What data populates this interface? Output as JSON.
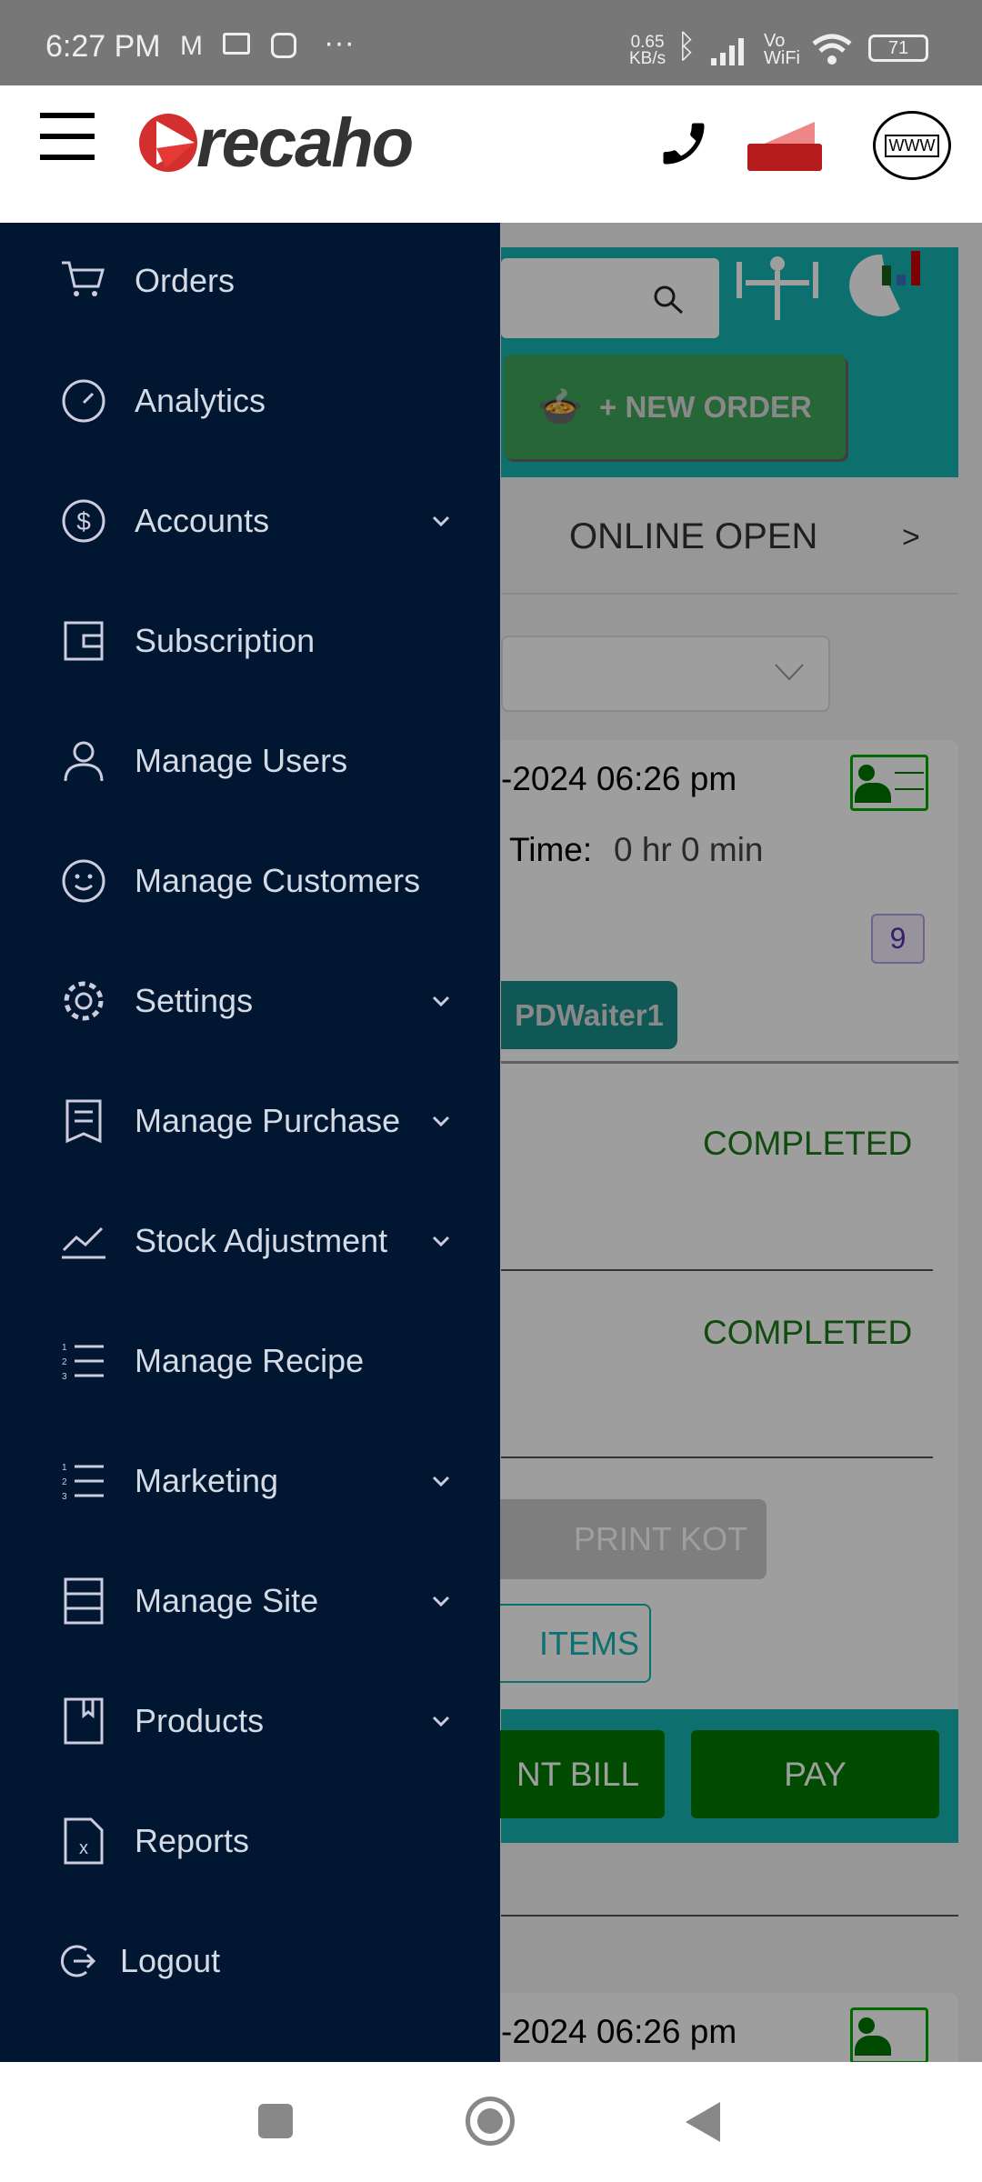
{
  "status_bar": {
    "time": "6:27 PM",
    "net_speed_value": "0.65",
    "net_speed_unit": "KB/s",
    "vo": "Vo",
    "wifi_label": "WiFi",
    "battery": "71",
    "more": "···"
  },
  "header": {
    "brand": "recaho",
    "brand_color": "#d32f2f",
    "icons": [
      "menu-icon",
      "phone-icon",
      "ticket-settings-icon",
      "www-globe-icon"
    ],
    "www": "WWW"
  },
  "background": {
    "new_order": "+ NEW ORDER",
    "tab": "ONLINE OPEN",
    "tab_next": ">",
    "card1": {
      "date": "-2024 06:26 pm",
      "time_label": "Time:",
      "time_value": "0 hr 0 min",
      "badge": "9",
      "waiter": "PDWaiter1"
    },
    "status1": "COMPLETED",
    "status2": "COMPLETED",
    "print_kot": "PRINT KOT",
    "items": "ITEMS",
    "print_bill": "NT BILL",
    "pay": "PAY",
    "card2": {
      "date": "-2024 06:26 pm"
    }
  },
  "drawer": {
    "items": [
      {
        "label": "Orders",
        "icon": "cart-icon",
        "expand": false
      },
      {
        "label": "Analytics",
        "icon": "speedometer-icon",
        "expand": false
      },
      {
        "label": "Accounts",
        "icon": "dollar-icon",
        "expand": true
      },
      {
        "label": "Subscription",
        "icon": "wallet-icon",
        "expand": false
      },
      {
        "label": "Manage Users",
        "icon": "user-icon",
        "expand": false
      },
      {
        "label": "Manage Customers",
        "icon": "smile-icon",
        "expand": false
      },
      {
        "label": "Settings",
        "icon": "gear-icon",
        "expand": true
      },
      {
        "label": "Manage Purchase",
        "icon": "receipt-icon",
        "expand": true
      },
      {
        "label": "Stock Adjustment",
        "icon": "chart-line-icon",
        "expand": true
      },
      {
        "label": "Manage Recipe",
        "icon": "list-icon",
        "expand": false
      },
      {
        "label": "Marketing",
        "icon": "list-icon",
        "expand": true
      },
      {
        "label": "Manage Site",
        "icon": "site-icon",
        "expand": true
      },
      {
        "label": "Products",
        "icon": "bookmark-icon",
        "expand": true
      },
      {
        "label": "Reports",
        "icon": "excel-file-icon",
        "expand": false
      }
    ],
    "logout": "Logout"
  },
  "colors": {
    "drawer_bg": "#001631",
    "teal": "#17b3b3",
    "green": "#1a7a1a",
    "pay_green": "#007a00"
  }
}
